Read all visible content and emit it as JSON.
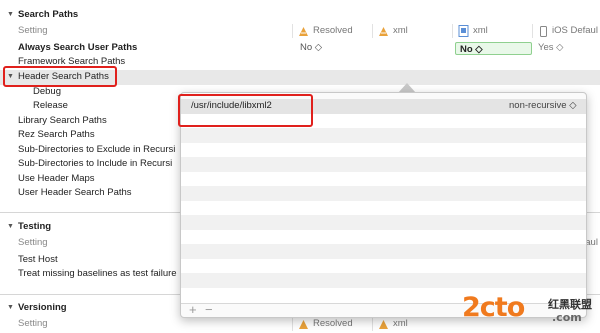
{
  "columns": {
    "setting": "Setting",
    "resolved": "Resolved",
    "xml_target": "xml",
    "xml_project": "xml",
    "ios_default": "iOS Defaul"
  },
  "sections": {
    "search_paths": {
      "title": "Search Paths",
      "always_search": {
        "label": "Always Search User Paths",
        "resolved": "No ◇",
        "project": "No ◇",
        "default": "Yes ◇"
      },
      "framework": "Framework Search Paths",
      "header": "Header Search Paths",
      "debug": "Debug",
      "release": "Release",
      "library": "Library Search Paths",
      "rez": "Rez Search Paths",
      "subdirs_exclude": "Sub-Directories to Exclude in Recursi",
      "subdirs_include": "Sub-Directories to Include in Recursi",
      "use_header_maps": "Use Header Maps",
      "user_header": "User Header Search Paths"
    },
    "testing": {
      "title": "Testing",
      "test_host": "Test Host",
      "treat_missing": "Treat missing baselines as test failure"
    },
    "versioning": {
      "title": "Versioning"
    }
  },
  "popover": {
    "path": "/usr/include/libxml2",
    "mode": "non-recursive ◇",
    "add": "+",
    "remove": "−"
  },
  "watermark": {
    "brand": "2cto",
    "cn": "红黑联盟",
    "url": ".com"
  },
  "colors": {
    "highlight_border": "#e0201c",
    "value_box": "#e9f8e9"
  }
}
